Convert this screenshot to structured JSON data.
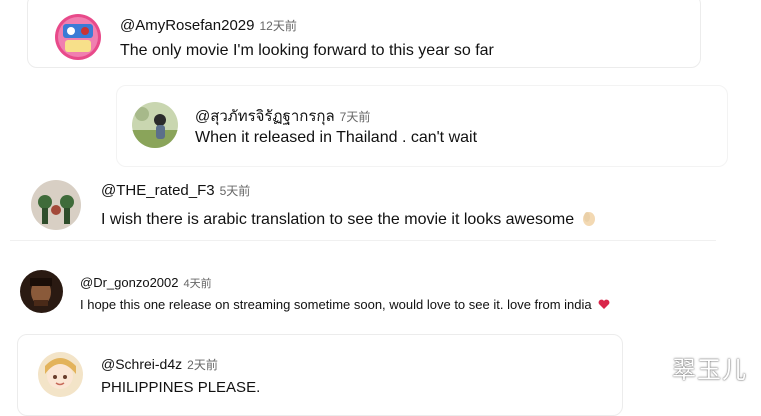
{
  "comments": [
    {
      "username": "@AmyRosefan2029",
      "time": "12天前",
      "text": "The only movie I'm looking forward to this year so far"
    },
    {
      "username": "@สุวภัทรจิรัฏฐากรกุล",
      "time": "7天前",
      "text": "When it released in Thailand . can't wait"
    },
    {
      "username": "@THE_rated_F3",
      "time": "5天前",
      "text": "I wish there is arabic translation to see the movie it looks awesome",
      "emoji": "clapping-hand-emoji"
    },
    {
      "username": "@Dr_gonzo2002",
      "time": "4天前",
      "text": "I hope this one release on streaming sometime soon, would love to see it. love from india",
      "emoji": "heart-emoji"
    },
    {
      "username": "@Schrei-d4z",
      "time": "2天前",
      "text": "PHILIPPINES PLEASE."
    }
  ],
  "watermark": "翠玉儿",
  "colors": {
    "text": "#111111",
    "timestamp": "#666666",
    "heart": "#d9264a"
  }
}
